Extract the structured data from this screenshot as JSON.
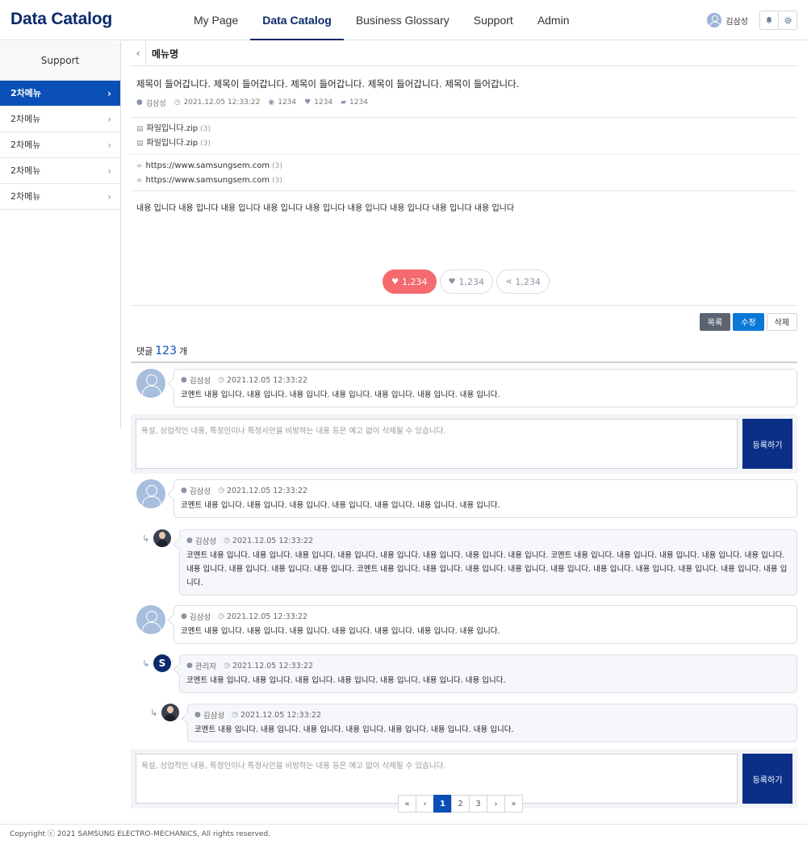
{
  "header": {
    "logo": "Data Catalog",
    "nav": [
      "My Page",
      "Data Catalog",
      "Business Glossary",
      "Support",
      "Admin"
    ],
    "active_nav": "Data Catalog",
    "user_name": "김삼성"
  },
  "sidebar": {
    "title": "Support",
    "items": [
      {
        "label": "2차메뉴",
        "active": true
      },
      {
        "label": "2차메뉴",
        "active": false
      },
      {
        "label": "2차메뉴",
        "active": false
      },
      {
        "label": "2차메뉴",
        "active": false
      },
      {
        "label": "2차메뉴",
        "active": false
      }
    ]
  },
  "subheader": {
    "back": "‹",
    "menu_name": "메뉴명"
  },
  "post": {
    "title": "제목이 들어갑니다. 제목이 들어갑니다. 제목이 들어갑니다. 제목이 들어갑니다. 제목이 들어갑니다.",
    "author": "김삼성",
    "date": "2021.12.05 12:33:22",
    "views": "1234",
    "likes": "1234",
    "comments": "1234",
    "files": [
      {
        "name": "파일입니다.zip",
        "count": "(3)"
      },
      {
        "name": "파일입니다.zip",
        "count": "(3)"
      }
    ],
    "links": [
      {
        "url": "https://www.samsungsem.com",
        "count": "(3)"
      },
      {
        "url": "https://www.samsungsem.com",
        "count": "(3)"
      }
    ],
    "body": "내용 입니다 내용 입니다 내용 입니다 내용 입니다 내용 입니다 내용 입니다 내용 입니다 내용 입니다 내용 입니다"
  },
  "reactions": {
    "like": "1,234",
    "heart": "1,234",
    "share": "1,234"
  },
  "actions": {
    "list": "목록",
    "edit": "수정",
    "delete": "삭제"
  },
  "comments_header": {
    "prefix": "댓글",
    "count": "123",
    "suffix": "개"
  },
  "comments": {
    "c1": {
      "author": "김삼성",
      "date": "2021.12.05 12:33:22",
      "text": "코멘트 내용 입니다. 내용 입니다. 내용 입니다. 내용 입니다. 내용 입니다. 내용 입니다. 내용 입니다."
    },
    "c2": {
      "author": "김삼성",
      "date": "2021.12.05 12:33:22",
      "text": "코멘트 내용 입니다. 내용 입니다. 내용 입니다. 내용 입니다. 내용 입니다. 내용 입니다. 내용 입니다."
    },
    "r1": {
      "author": "김삼성",
      "date": "2021.12.05 12:33:22",
      "text": "코멘트 내용 입니다. 내용 입니다. 내용 입니다. 내용 입니다. 내용 입니다. 내용 입니다. 내용 입니다. 내용 입니다. 코멘트 내용 입니다. 내용 입니다. 내용 입니다. 내용 입니다. 내용 입니다. 내용 입니다. 내용 입니다. 내용 입니다. 내용 입니다. 코멘트 내용 입니다. 내용 입니다. 내용 입니다. 내용 입니다. 내용 입니다. 내용 입니다. 내용 입니다. 내용 입니다. 내용 입니다. 내용 입니다."
    },
    "c3": {
      "author": "김삼성",
      "date": "2021.12.05 12:33:22",
      "text": "코멘트 내용 입니다. 내용 입니다. 내용 입니다. 내용 입니다. 내용 입니다. 내용 입니다. 내용 입니다."
    },
    "r2": {
      "author": "관리자",
      "avatar_letter": "S",
      "date": "2021.12.05 12:33:22",
      "text": "코멘트 내용 입니다. 내용 입니다. 내용 입니다. 내용 입니다. 내용 입니다. 내용 입니다. 내용 입니다."
    },
    "r3": {
      "author": "김삼성",
      "date": "2021.12.05 12:33:22",
      "text": "코멘트 내용 입니다. 내용 입니다. 내용 입니다. 내용 입니다. 내용 입니다. 내용 입니다. 내용 입니다."
    }
  },
  "write": {
    "placeholder": "욕설, 상업적인 내용, 특정인이나 특정사안을 비방하는 내용 등은 예고 없이 삭제될 수 있습니다.",
    "submit": "등록하기"
  },
  "pagination": {
    "first": "«",
    "prev": "‹",
    "pages": [
      "1",
      "2",
      "3"
    ],
    "current": "1",
    "next": "›",
    "last": "»"
  },
  "footer": {
    "copyright": "Copyright ⓒ 2021 SAMSUNG ELECTRO-MECHANICS, All rights reserved."
  },
  "colors": {
    "brand": "#0a2a6b",
    "accent": "#0a4fb5",
    "like": "#f46a6e",
    "edit": "#0a79d6",
    "submit": "#0b2f87"
  }
}
